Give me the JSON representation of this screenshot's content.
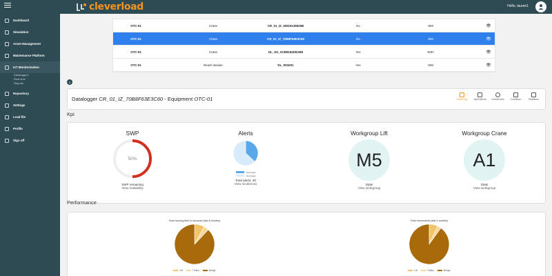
{
  "header": {
    "logo_text": "cleverload",
    "greeting": "Hello, lauren1"
  },
  "colors": {
    "sidebar": "#2e4a52",
    "brand": "#f7931e",
    "selected_row": "#2f80ed",
    "swp_ring": "#d32f1e",
    "alerts_blue": "#5aa8ec",
    "alerts_light": "#d7ebfa",
    "kpi_circle": "#e1f3f3",
    "pie_bridge": "#a86a0a",
    "pie_lift": "#f3c36b",
    "pie_trolley": "#f6d79a"
  },
  "sidebar": {
    "items": [
      {
        "label": "Dashboard",
        "icon": "dashboard-icon"
      },
      {
        "label": "Simulation",
        "icon": "simulation-icon"
      },
      {
        "label": "Asset Management",
        "icon": "asset-icon"
      },
      {
        "label": "Maintenance Platform",
        "icon": "maintenance-icon"
      },
      {
        "label": "IoT Monitorization",
        "icon": "iot-icon"
      },
      {
        "label": "Repository",
        "icon": "repository-icon"
      },
      {
        "label": "Settings",
        "icon": "settings-icon"
      },
      {
        "label": "Load file",
        "icon": "load-file-icon"
      },
      {
        "label": "Profile",
        "icon": "profile-icon"
      },
      {
        "label": "Sign off",
        "icon": "sign-off-icon"
      }
    ],
    "subitems": [
      "Dataloggers",
      "Real time",
      "Reports"
    ]
  },
  "table": {
    "rows": [
      {
        "equipment_id": "OTC-01",
        "equipment": "Crane",
        "datalogger": "CR_01_IZ_40915139626B",
        "live": "No",
        "connection": "SIM"
      },
      {
        "equipment_id": "OTC-01",
        "equipment": "Crane",
        "datalogger": "CR_01_IZ_70B8F63E3C60",
        "live": "No",
        "connection": "SIM"
      },
      {
        "equipment_id": "OTC-01",
        "equipment": "Crane",
        "datalogger": "DL_IZ1_0CB8154D9AB8",
        "live": "Yes",
        "connection": "WIFI"
      },
      {
        "equipment_id": "OTC-01",
        "equipment": "Reach stacker",
        "datalogger": "DL_RSIZ01",
        "live": "Yes",
        "connection": "SIM"
      }
    ],
    "selected_index": 1,
    "eye_icon": "eye-icon"
  },
  "step_number": "1",
  "datalogger_header": {
    "prefix": "Datalogger ",
    "datalogger_id": "CR_01_IZ_70B8F63E3C60",
    "middle": " - Equipment ",
    "equipment_id": "OTC-01",
    "tabs": [
      "Summary",
      "Operations",
      "Incidences",
      "Condition",
      "Statistics"
    ],
    "active_tab": "Summary"
  },
  "kpi": {
    "section_title": "Kpi",
    "swp": {
      "title": "SWP",
      "value": "50%",
      "percent": 50,
      "label": "SWP remaining",
      "link": "View realiability"
    },
    "alerts": {
      "title": "Alerts",
      "legend": [
        "Overheats",
        "Overheats"
      ],
      "slices": [
        37,
        63
      ],
      "total_label": "Total alerts: 30",
      "link": "View incidences"
    },
    "workgroup_lift": {
      "title": "Workgroup Lift",
      "value": "M5",
      "label": "Stats",
      "link": "View workgroup"
    },
    "workgroup_crane": {
      "title": "Workgroup Crane",
      "value": "A1",
      "label": "Stats",
      "link": "View workgroup"
    }
  },
  "performance": {
    "section_title": "Performance",
    "chart_data": [
      {
        "type": "pie",
        "title": "Total moving time in seconds (last 6 months)",
        "categories": [
          "Lift",
          "Trolley",
          "Bridge"
        ],
        "values": [
          8,
          4,
          88
        ]
      },
      {
        "type": "pie",
        "title": "Total movements (last 6 months)",
        "categories": [
          "Lift",
          "Trolley",
          "Bridge"
        ],
        "values": [
          7,
          3,
          90
        ]
      }
    ]
  }
}
